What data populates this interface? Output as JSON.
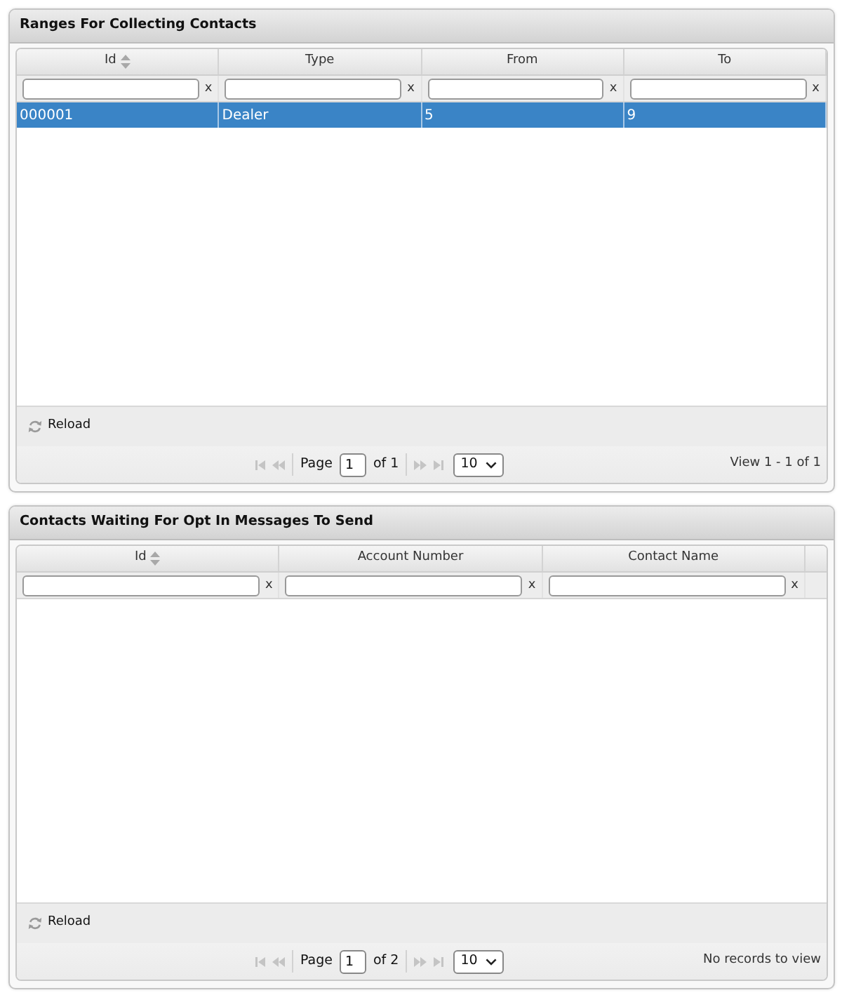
{
  "panels": [
    {
      "title": "Ranges For Collecting Contacts",
      "scroll_gutter": false,
      "columns": [
        {
          "label": "Id",
          "sortable": true,
          "filter_clear": "x"
        },
        {
          "label": "Type",
          "sortable": false,
          "filter_clear": "x"
        },
        {
          "label": "From",
          "sortable": false,
          "filter_clear": "x"
        },
        {
          "label": "To",
          "sortable": false,
          "filter_clear": "x"
        }
      ],
      "rows": [
        {
          "selected": true,
          "cells": [
            "000001",
            "Dealer",
            "5",
            "9"
          ]
        }
      ],
      "toolbar": {
        "reload": "Reload"
      },
      "pager": {
        "nav_disabled": true,
        "page_label": "Page",
        "page": "1",
        "total": "of 1",
        "page_size": "10",
        "info": "View 1 - 1 of 1"
      }
    },
    {
      "title": "Contacts Waiting For Opt In Messages To Send",
      "scroll_gutter": true,
      "columns": [
        {
          "label": "Id",
          "sortable": true,
          "filter_clear": "x"
        },
        {
          "label": "Account Number",
          "sortable": false,
          "filter_clear": "x"
        },
        {
          "label": "Contact Name",
          "sortable": false,
          "filter_clear": "x"
        }
      ],
      "toolbar": {
        "reload": "Reload"
      },
      "pager": {
        "nav_disabled": true,
        "page_label": "Page",
        "page": "1",
        "total": "of 2",
        "page_size": "10",
        "info": "No records to view"
      }
    }
  ]
}
